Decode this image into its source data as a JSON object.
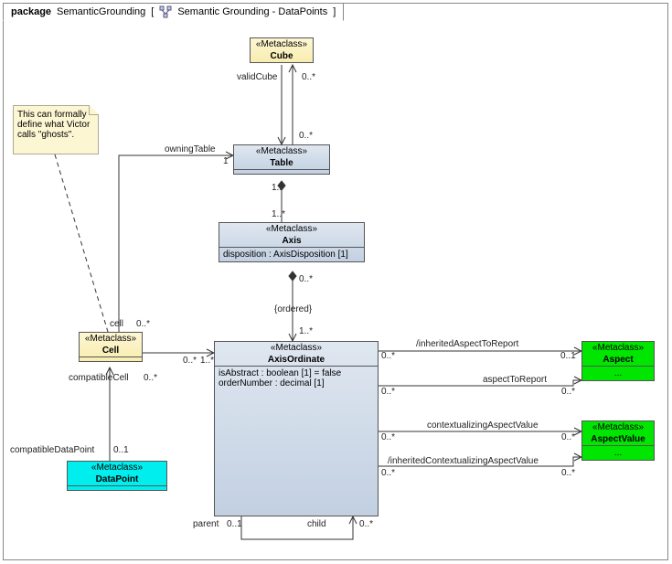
{
  "package": {
    "keyword": "package",
    "name": "SemanticGrounding",
    "tab_icon_alt": "diagram-icon",
    "tab_diagram_name": "Semantic Grounding - DataPoints"
  },
  "note": {
    "text": "This can formally define what Victor calls \"ghosts\"."
  },
  "classes": {
    "cube": {
      "stereo": "«Metaclass»",
      "name": "Cube"
    },
    "table": {
      "stereo": "«Metaclass»",
      "name": "Table"
    },
    "axis": {
      "stereo": "«Metaclass»",
      "name": "Axis",
      "attr1": "disposition : AxisDisposition [1]"
    },
    "axisOrdinate": {
      "stereo": "«Metaclass»",
      "name": "AxisOrdinate",
      "attr1": "isAbstract : boolean [1] = false",
      "attr2": "orderNumber : decimal [1]"
    },
    "cell": {
      "stereo": "«Metaclass»",
      "name": "Cell"
    },
    "datapoint": {
      "stereo": "«Metaclass»",
      "name": "DataPoint"
    },
    "aspect": {
      "stereo": "«Metaclass»",
      "name": "Aspect",
      "ellipsis": "..."
    },
    "aspectValue": {
      "stereo": "«Metaclass»",
      "name": "AspectValue",
      "ellipsis": "..."
    }
  },
  "labels": {
    "validCube": "validCube",
    "owningTable": "owningTable",
    "cell": "cell",
    "compatibleCell": "compatibleCell",
    "compatibleDataPoint": "compatibleDataPoint",
    "ordered": "{ordered}",
    "parent": "parent",
    "child": "child",
    "inheritedAspectToReport": "/inheritedAspectToReport",
    "aspectToReport": "aspectToReport",
    "contextualizingAspectValue": "contextualizingAspectValue",
    "inheritedContextualizingAspectValue": "/inheritedContextualizingAspectValue"
  },
  "mults": {
    "m0s": "0..*",
    "m1s": "1..*",
    "m1": "1",
    "m01": "0..1",
    "m0s_dup": "0..*",
    "m01_dup": "0..1"
  }
}
